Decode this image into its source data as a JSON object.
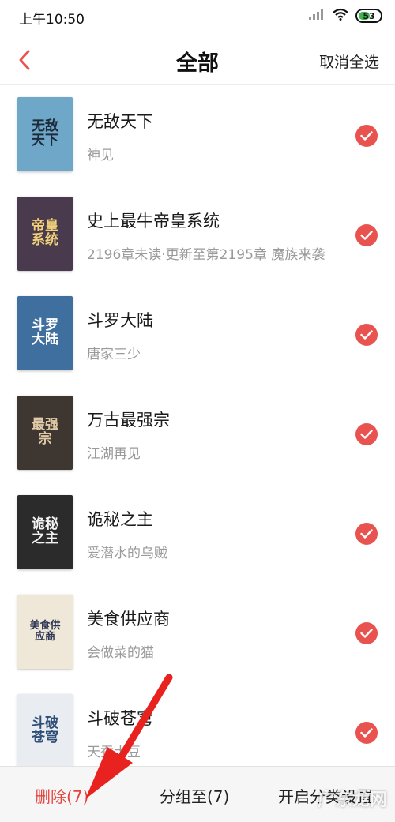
{
  "status_bar": {
    "time": "上午10:50",
    "battery": "53",
    "battery_level": 0.53,
    "battery_color": "#3fb34f"
  },
  "header": {
    "title": "全部",
    "deselect_all": "取消全选"
  },
  "accent_color": "#e9534f",
  "books": [
    {
      "title": "无敌天下",
      "subtitle": "神见",
      "checked": true,
      "cover_text": "无敌天下",
      "cover_bg": "#6fa7c9",
      "cover_fg": "#1c2a3a"
    },
    {
      "title": "史上最牛帝皇系统",
      "subtitle": "2196章未读·更新至第2195章 魔族来袭",
      "checked": true,
      "cover_text": "帝皇系统",
      "cover_bg": "#4a3a4e",
      "cover_fg": "#f3d37a"
    },
    {
      "title": "斗罗大陆",
      "subtitle": "唐家三少",
      "checked": true,
      "cover_text": "斗罗大陆",
      "cover_bg": "#3f6f9e",
      "cover_fg": "#ffffff"
    },
    {
      "title": "万古最强宗",
      "subtitle": "江湖再见",
      "checked": true,
      "cover_text": "最强宗",
      "cover_bg": "#3d3631",
      "cover_fg": "#e0c9a6"
    },
    {
      "title": "诡秘之主",
      "subtitle": "爱潜水的乌贼",
      "checked": true,
      "cover_text": "诡秘之主",
      "cover_bg": "#2b2b2b",
      "cover_fg": "#f2f2f2"
    },
    {
      "title": "美食供应商",
      "subtitle": "会做菜的猫",
      "checked": true,
      "cover_text": "美食供应商",
      "cover_bg": "#efe7d8",
      "cover_fg": "#2a3350"
    },
    {
      "title": "斗破苍穹",
      "subtitle": "天蚕土豆",
      "checked": true,
      "cover_text": "斗破苍穹",
      "cover_bg": "#e9edf2",
      "cover_fg": "#2f4e77"
    }
  ],
  "bottom_bar": {
    "delete": "删除(7)",
    "group": "分组至(7)",
    "top": "开启分类设置"
  },
  "watermark": "广东龙网"
}
